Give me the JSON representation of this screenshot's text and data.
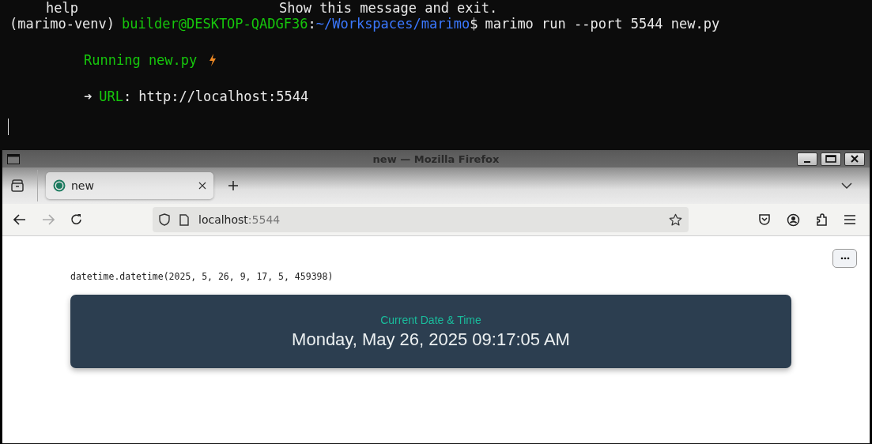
{
  "terminal": {
    "cut_line": {
      "command": "help",
      "description": "Show this message and exit."
    },
    "prompt": {
      "env": "(marimo-venv)",
      "user_host": "builder@DESKTOP-QADGF36",
      "separator": ":",
      "path": "~/Workspaces/marimo",
      "symbol": "$",
      "command": "marimo run --port 5544 new.py"
    },
    "running": {
      "text": "Running new.py"
    },
    "url": {
      "arrow": "➜",
      "label": "URL",
      "separator": ":",
      "value": "http://localhost:5544"
    }
  },
  "window": {
    "title": "new — Mozilla Firefox"
  },
  "tabs": [
    {
      "label": "new",
      "selected": true
    }
  ],
  "address_bar": {
    "host": "localhost",
    "port": ":5544"
  },
  "notebook": {
    "output": "datetime.datetime(2025, 5, 26, 9, 17, 5, 459398)",
    "card": {
      "caption": "Current Date & Time",
      "value": "Monday, May 26, 2025 09:17:05 AM"
    }
  }
}
